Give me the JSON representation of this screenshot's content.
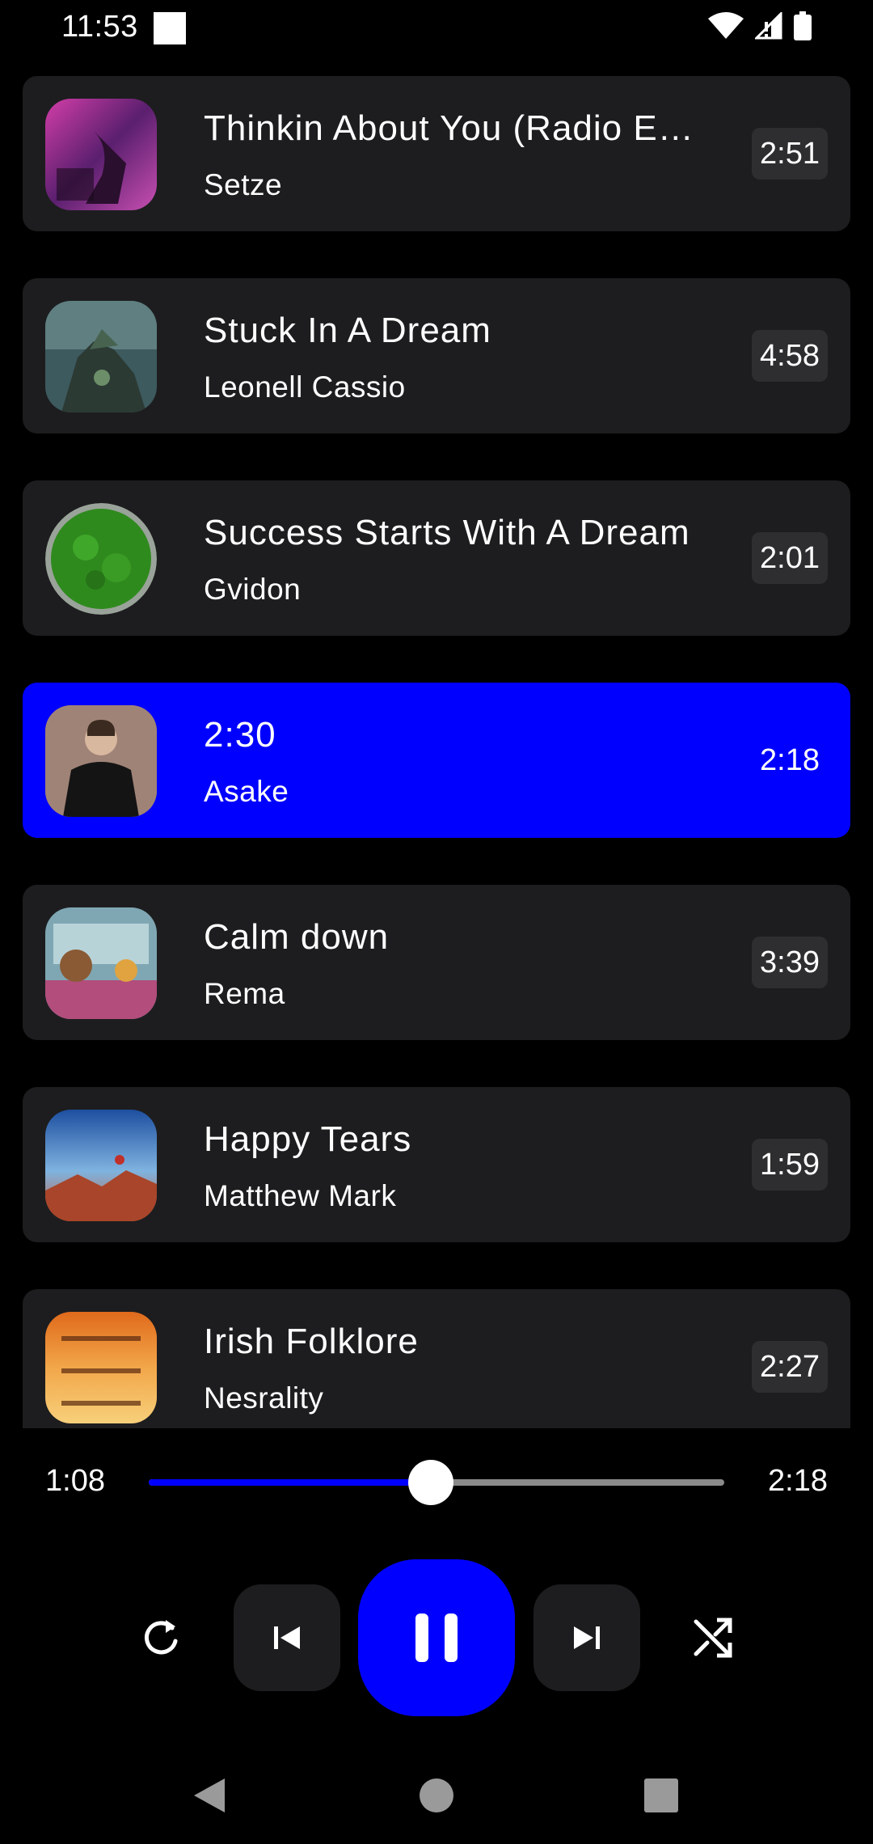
{
  "status_bar": {
    "time": "11:53"
  },
  "tracks": [
    {
      "title": "Thinkin About You (Radio Edit)",
      "artist": "Setze",
      "duration": "2:51",
      "active": false
    },
    {
      "title": "Stuck In A Dream",
      "artist": "Leonell Cassio",
      "duration": "4:58",
      "active": false
    },
    {
      "title": "Success Starts With A Dream",
      "artist": "Gvidon",
      "duration": "2:01",
      "active": false
    },
    {
      "title": "2:30",
      "artist": "Asake",
      "duration": "2:18",
      "active": true
    },
    {
      "title": "Calm down",
      "artist": "Rema",
      "duration": "3:39",
      "active": false
    },
    {
      "title": "Happy Tears",
      "artist": "Matthew Mark",
      "duration": "1:59",
      "active": false
    },
    {
      "title": "Irish Folklore",
      "artist": "Nesrality",
      "duration": "2:27",
      "active": false
    }
  ],
  "player": {
    "elapsed": "1:08",
    "total": "2:18",
    "progress_fraction": 0.49
  },
  "controls": {
    "repeat": "repeat-icon",
    "previous": "skip-previous-icon",
    "play_pause": "pause-icon",
    "next": "skip-next-icon",
    "shuffle": "shuffle-icon"
  },
  "colors": {
    "accent": "#0000ff",
    "card": "#1d1d1f",
    "background": "#000000"
  }
}
